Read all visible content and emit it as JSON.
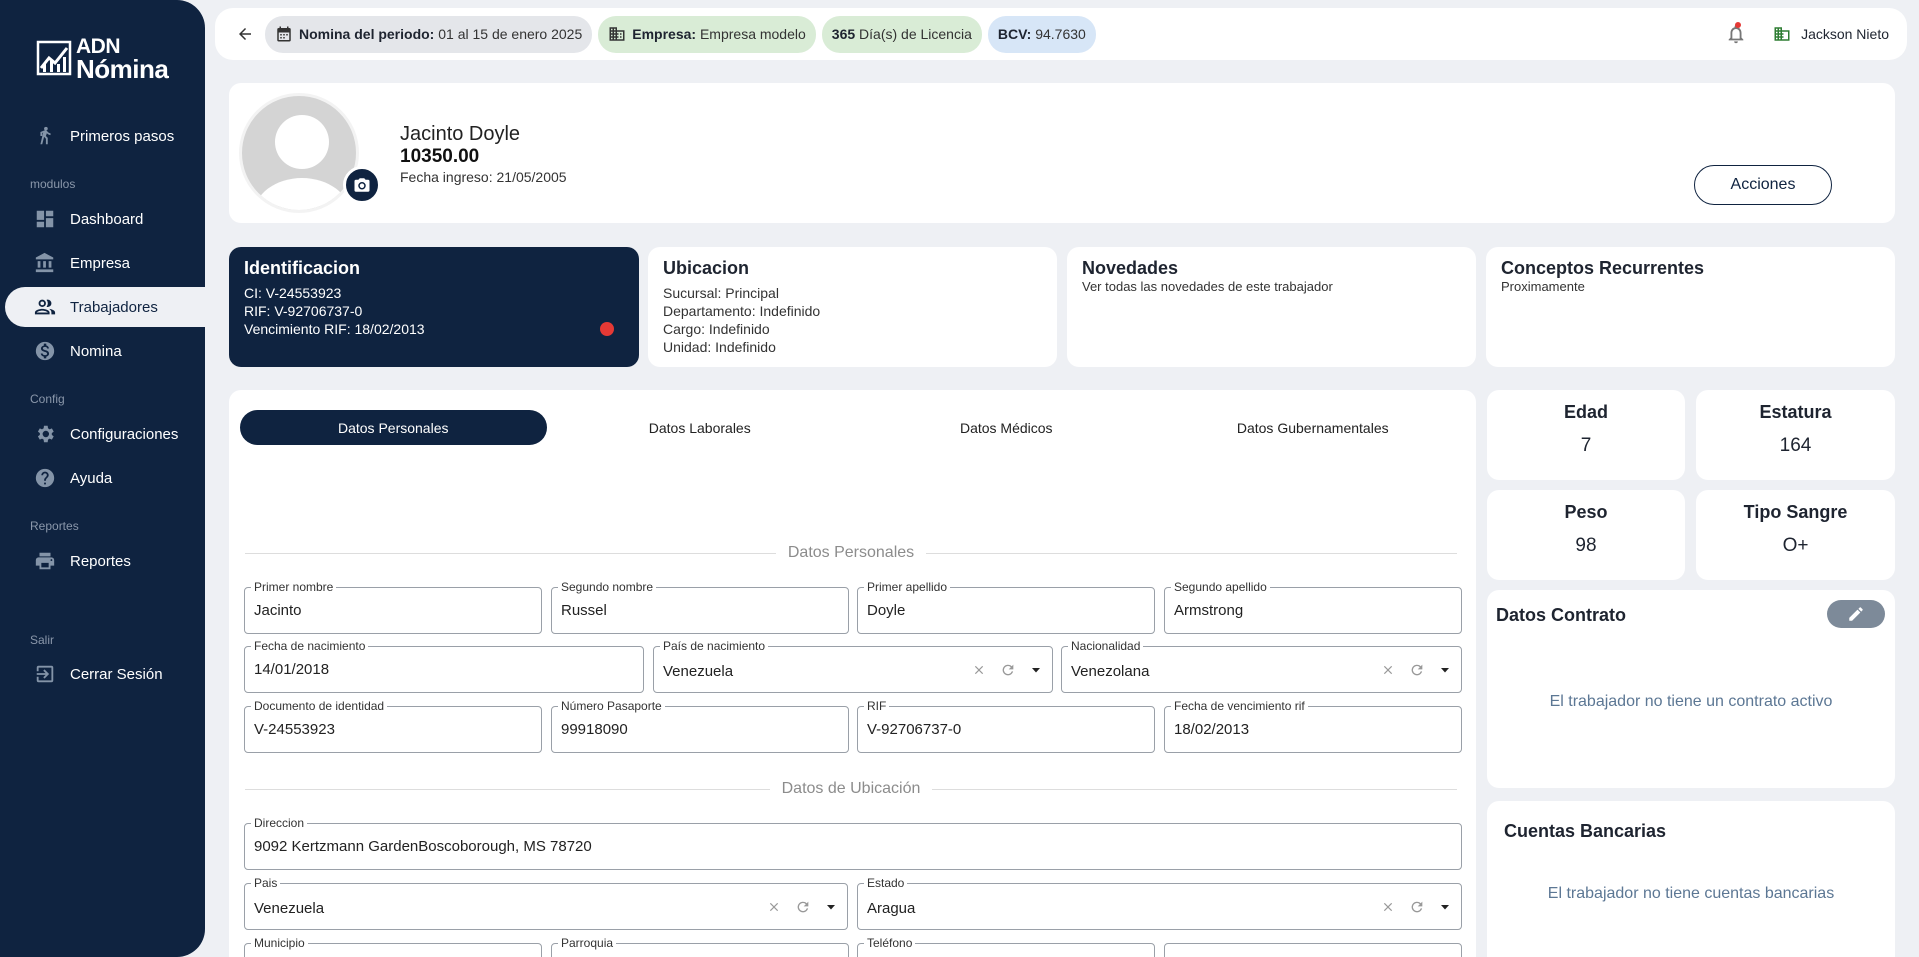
{
  "app": {
    "logo_line1": "ADN",
    "logo_line2": "Nómina"
  },
  "sidebar": {
    "items": [
      {
        "label": "Primeros pasos",
        "icon": "walk-icon"
      },
      {
        "label": "Dashboard",
        "icon": "dashboard-icon"
      },
      {
        "label": "Empresa",
        "icon": "bank-icon"
      },
      {
        "label": "Trabajadores",
        "icon": "people-icon"
      },
      {
        "label": "Nomina",
        "icon": "dollar-icon"
      },
      {
        "label": "Configuraciones",
        "icon": "gear-icon"
      },
      {
        "label": "Ayuda",
        "icon": "help-icon"
      },
      {
        "label": "Reportes",
        "icon": "printer-icon"
      },
      {
        "label": "Cerrar Sesión",
        "icon": "logout-icon"
      }
    ],
    "sections": {
      "modulos": "modulos",
      "config": "Config",
      "reportes": "Reportes",
      "salir": "Salir"
    },
    "active": "Trabajadores"
  },
  "topbar": {
    "periodo_label": "Nomina del periodo:",
    "periodo_value": "01 al 15 de enero 2025",
    "empresa_label": "Empresa:",
    "empresa_value": "Empresa modelo",
    "licencia_count": "365",
    "licencia_label": "Día(s) de Licencia",
    "bcv_label": "BCV:",
    "bcv_value": "94.7630",
    "user_name": "Jackson Nieto"
  },
  "profile": {
    "name": "Jacinto Doyle",
    "salary": "10350.00",
    "fecha_ingreso": "Fecha ingreso: 21/05/2005",
    "acciones": "Acciones"
  },
  "cards": {
    "identificacion": {
      "title": "Identificacion",
      "ci": "CI: V-24553923",
      "rif": "RIF: V-92706737-0",
      "venc": "Vencimiento RIF: 18/02/2013"
    },
    "ubicacion": {
      "title": "Ubicacion",
      "sucursal": "Sucursal: Principal",
      "departamento": "Departamento: Indefinido",
      "cargo": "Cargo: Indefinido",
      "unidad": "Unidad: Indefinido"
    },
    "novedades": {
      "title": "Novedades",
      "sub": "Ver todas las novedades de este trabajador"
    },
    "conceptos": {
      "title": "Conceptos Recurrentes",
      "sub": "Proximamente"
    }
  },
  "tabs": [
    "Datos Personales",
    "Datos Laborales",
    "Datos Médicos",
    "Datos Gubernamentales"
  ],
  "form": {
    "section_personales": "Datos Personales",
    "section_ubicacion": "Datos de Ubicación",
    "primer_nombre": {
      "label": "Primer nombre",
      "value": "Jacinto"
    },
    "segundo_nombre": {
      "label": "Segundo nombre",
      "value": "Russel"
    },
    "primer_apellido": {
      "label": "Primer apellido",
      "value": "Doyle"
    },
    "segundo_apellido": {
      "label": "Segundo apellido",
      "value": "Armstrong"
    },
    "fecha_nacimiento": {
      "label": "Fecha de nacimiento",
      "value": "14/01/2018"
    },
    "pais_nacimiento": {
      "label": "País de nacimiento",
      "value": "Venezuela"
    },
    "nacionalidad": {
      "label": "Nacionalidad",
      "value": "Venezolana"
    },
    "documento": {
      "label": "Documento de identidad",
      "value": "V-24553923"
    },
    "pasaporte": {
      "label": "Número Pasaporte",
      "value": "99918090"
    },
    "rif": {
      "label": "RIF",
      "value": "V-92706737-0"
    },
    "venc_rif": {
      "label": "Fecha de vencimiento rif",
      "value": "18/02/2013"
    },
    "direccion": {
      "label": "Direccion",
      "value": "9092 Kertzmann GardenBoscoborough, MS 78720"
    },
    "pais": {
      "label": "Pais",
      "value": "Venezuela"
    },
    "estado": {
      "label": "Estado",
      "value": "Aragua"
    },
    "municipio": {
      "label": "Municipio"
    },
    "parroquia": {
      "label": "Parroquia"
    },
    "telefono": {
      "label": "Teléfono"
    }
  },
  "stats": {
    "edad": {
      "label": "Edad",
      "value": "7"
    },
    "estatura": {
      "label": "Estatura",
      "value": "164"
    },
    "peso": {
      "label": "Peso",
      "value": "98"
    },
    "sangre": {
      "label": "Tipo Sangre",
      "value": "O+"
    }
  },
  "contrato": {
    "title": "Datos Contrato",
    "empty": "El trabajador no tiene un contrato activo"
  },
  "bancos": {
    "title": "Cuentas Bancarias",
    "empty": "El trabajador no tiene cuentas bancarias"
  },
  "colors": {
    "primary": "#0f2340",
    "accent_red": "#e53935",
    "chip_green": "#d9ecd6",
    "chip_blue": "#d7e6f7"
  }
}
